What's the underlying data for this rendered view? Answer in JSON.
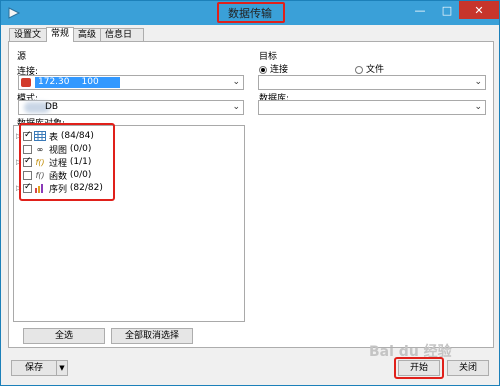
{
  "window": {
    "title": "数据传输"
  },
  "tabs": [
    {
      "label": "设置文件"
    },
    {
      "label": "常规"
    },
    {
      "label": "高级"
    },
    {
      "label": "信息日志"
    }
  ],
  "source": {
    "group_label": "源",
    "connection_label": "连接:",
    "connection_value": "172.30",
    "connection_value_2": "100",
    "mode_label": "模式:",
    "mode_value": "DB",
    "objects_label": "数据库对象:",
    "tree": [
      {
        "label": "表",
        "count": "(84/84)",
        "checked": true,
        "icon": "table-icon",
        "expandable": true
      },
      {
        "label": "视图",
        "count": "(0/0)",
        "checked": false,
        "icon": "view-icon",
        "expandable": false
      },
      {
        "label": "过程",
        "count": "(1/1)",
        "checked": true,
        "icon": "procedure-icon",
        "expandable": true
      },
      {
        "label": "函数",
        "count": "(0/0)",
        "checked": false,
        "icon": "function-icon",
        "expandable": false
      },
      {
        "label": "序列",
        "count": "(82/82)",
        "checked": true,
        "icon": "sequence-icon",
        "expandable": true
      }
    ],
    "select_all_label": "全选",
    "deselect_all_label": "全部取消选择"
  },
  "target": {
    "group_label": "目标",
    "connection_radio": "连接",
    "file_radio": "文件",
    "database_label": "数据库:"
  },
  "footer": {
    "save_label": "保存",
    "start_label": "开始",
    "close_label": "关闭"
  },
  "colors": {
    "titlebar": "#3aa0d8",
    "highlight": "#e0201a",
    "selection": "#3399ff"
  }
}
